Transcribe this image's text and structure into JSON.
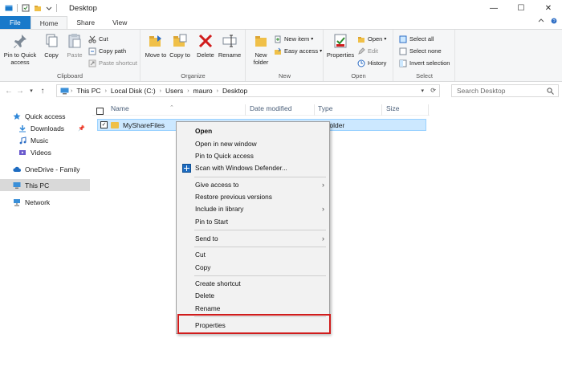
{
  "window": {
    "title": "Desktop",
    "minimize_glyph": "—",
    "maximize_glyph": "☐",
    "close_glyph": "✕"
  },
  "ribbon_tabs": [
    "File",
    "Home",
    "Share",
    "View"
  ],
  "ribbon": {
    "clipboard": {
      "label": "Clipboard",
      "pin_to_quick_access": "Pin to Quick access",
      "copy": "Copy",
      "paste": "Paste",
      "cut": "Cut",
      "copy_path": "Copy path",
      "paste_shortcut": "Paste shortcut"
    },
    "organize": {
      "label": "Organize",
      "move_to": "Move to",
      "copy_to": "Copy to",
      "delete": "Delete",
      "rename": "Rename"
    },
    "new": {
      "label": "New",
      "new_folder": "New folder",
      "new_item": "New item",
      "easy_access": "Easy access"
    },
    "open": {
      "label": "Open",
      "properties": "Properties",
      "open": "Open",
      "edit": "Edit",
      "history": "History"
    },
    "select": {
      "label": "Select",
      "select_all": "Select all",
      "select_none": "Select none",
      "invert_selection": "Invert selection"
    }
  },
  "address": {
    "crumbs": [
      "This PC",
      "Local Disk (C:)",
      "Users",
      "mauro",
      "Desktop"
    ],
    "search_placeholder": "Search Desktop"
  },
  "nav_pane": {
    "quick_access": "Quick access",
    "downloads": "Downloads",
    "music": "Music",
    "videos": "Videos",
    "onedrive": "OneDrive - Family",
    "this_pc": "This PC",
    "network": "Network"
  },
  "columns": {
    "name": "Name",
    "date_modified": "Date modified",
    "type": "Type",
    "size": "Size"
  },
  "file_row": {
    "name": "MyShareFiles",
    "type": "folder"
  },
  "context_menu": {
    "open": "Open",
    "open_new_window": "Open in new window",
    "pin_quick_access": "Pin to Quick access",
    "scan_defender": "Scan with Windows Defender...",
    "give_access": "Give access to",
    "restore_previous": "Restore previous versions",
    "include_library": "Include in library",
    "pin_start": "Pin to Start",
    "send_to": "Send to",
    "cut": "Cut",
    "copy": "Copy",
    "create_shortcut": "Create shortcut",
    "delete": "Delete",
    "rename": "Rename",
    "properties": "Properties"
  },
  "colors": {
    "file_tab": "#1979ca",
    "selection": "#cce8ff",
    "highlight_box": "#d01c1c",
    "folder": "#f0c048"
  }
}
